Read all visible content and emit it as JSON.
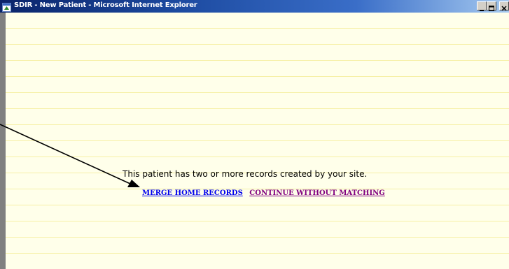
{
  "window": {
    "title": "SDIR - New Patient - Microsoft Internet Explorer"
  },
  "icons": {
    "app": "ie-window-icon",
    "minimize": "minimize-icon",
    "maximize": "maximize-icon",
    "close": "close-icon"
  },
  "main": {
    "message": "This patient has two or more records created by your site.",
    "links": {
      "merge": "MERGE HOME RECORDS",
      "continue": "CONTINUE WITHOUT MATCHING"
    }
  },
  "colors": {
    "titlebar": "#0a246a",
    "background": "#ffffea",
    "rule_line": "#f6f0a6",
    "link_unvisited": "#0000ee",
    "link_visited": "#800080"
  }
}
